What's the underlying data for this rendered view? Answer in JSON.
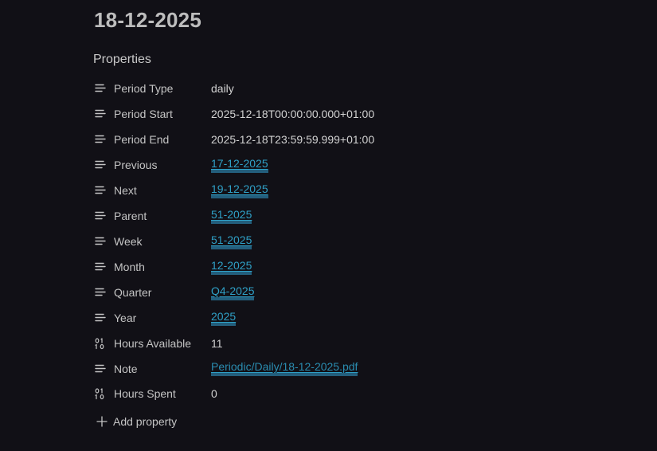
{
  "note": {
    "title": "18-12-2025"
  },
  "properties": {
    "heading": "Properties",
    "add_label": "Add property",
    "items": [
      {
        "key": "Period Type",
        "value": "daily",
        "icon": "text-lines-icon",
        "link": false
      },
      {
        "key": "Period Start",
        "value": "2025-12-18T00:00:00.000+01:00",
        "icon": "text-lines-icon",
        "link": false
      },
      {
        "key": "Period End",
        "value": "2025-12-18T23:59:59.999+01:00",
        "icon": "text-lines-icon",
        "link": false
      },
      {
        "key": "Previous",
        "value": "17-12-2025",
        "icon": "text-lines-icon",
        "link": true
      },
      {
        "key": "Next",
        "value": "19-12-2025",
        "icon": "text-lines-icon",
        "link": true
      },
      {
        "key": "Parent",
        "value": "51-2025",
        "icon": "text-lines-icon",
        "link": true
      },
      {
        "key": "Week",
        "value": "51-2025",
        "icon": "text-lines-icon",
        "link": true
      },
      {
        "key": "Month",
        "value": "12-2025",
        "icon": "text-lines-icon",
        "link": true
      },
      {
        "key": "Quarter",
        "value": "Q4-2025",
        "icon": "text-lines-icon",
        "link": true
      },
      {
        "key": "Year",
        "value": "2025",
        "icon": "text-lines-icon",
        "link": true
      },
      {
        "key": "Hours Available",
        "value": "11",
        "icon": "binary-number-icon",
        "link": false
      },
      {
        "key": "Note",
        "value": "Periodic/Daily/18-12-2025.pdf",
        "icon": "text-lines-icon",
        "link": true
      },
      {
        "key": "Hours Spent",
        "value": "0",
        "icon": "binary-number-icon",
        "link": false
      }
    ]
  },
  "colors": {
    "background": "#111016",
    "link": "#2fa0c6",
    "link_underline": "#235e7c",
    "text": "#c4c4c4"
  }
}
